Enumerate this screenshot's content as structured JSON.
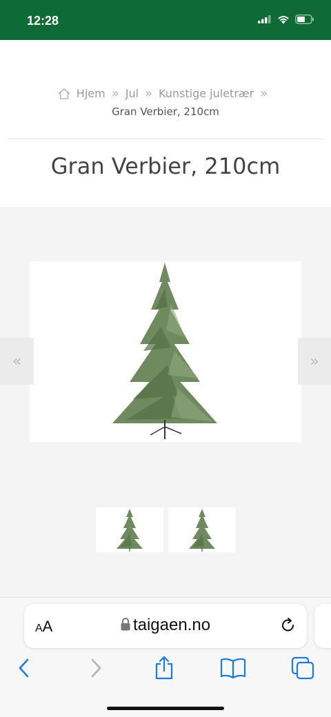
{
  "status_bar": {
    "time": "12:28",
    "background": "#0e6b35"
  },
  "breadcrumb": {
    "home_icon": "home-icon",
    "items": [
      "Hjem",
      "Jul",
      "Kunstige juletrær"
    ],
    "separator": "»",
    "current": "Gran Verbier, 210cm"
  },
  "product": {
    "title": "Gran Verbier, 210cm"
  },
  "gallery": {
    "prev_label": "«",
    "next_label": "»",
    "thumbnails": [
      "christmas-tree-image",
      "christmas-tree-image"
    ]
  },
  "browser": {
    "text_size_small": "A",
    "text_size_big": "A",
    "url": "taigaen.no",
    "accent": "#1a7ae0"
  }
}
